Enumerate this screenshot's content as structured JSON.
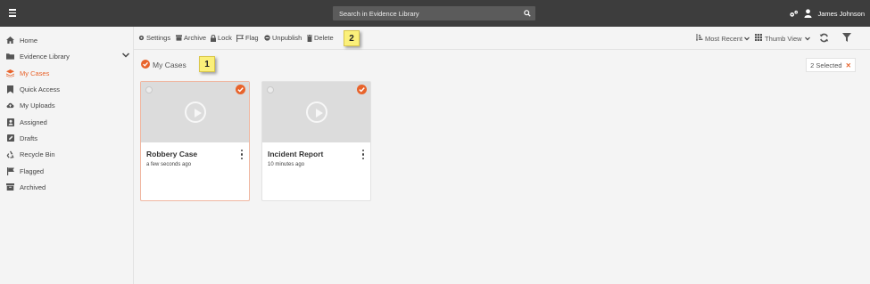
{
  "header": {
    "search_placeholder": "Search in Evidence Library",
    "user_name": "James Johnson"
  },
  "sidebar": {
    "items": [
      {
        "label": "Home",
        "icon": "home-icon"
      },
      {
        "label": "Evidence Library",
        "icon": "folder-icon"
      },
      {
        "label": "My Cases",
        "icon": "layers-icon",
        "active": true
      },
      {
        "label": "Quick Access",
        "icon": "bookmark-icon"
      },
      {
        "label": "My Uploads",
        "icon": "cloud-upload-icon"
      },
      {
        "label": "Assigned",
        "icon": "assigned-icon"
      },
      {
        "label": "Drafts",
        "icon": "edit-icon"
      },
      {
        "label": "Recycle Bin",
        "icon": "recycle-icon"
      },
      {
        "label": "Flagged",
        "icon": "flag-icon"
      },
      {
        "label": "Archived",
        "icon": "archive-icon"
      }
    ]
  },
  "toolbar": {
    "settings": "Settings",
    "archive": "Archive",
    "lock": "Lock",
    "flag": "Flag",
    "unpublish": "Unpublish",
    "delete": "Delete",
    "sort": "Most Recent",
    "view": "Thumb View"
  },
  "callouts": {
    "one": "1",
    "two": "2"
  },
  "section": {
    "title": "My Cases",
    "selected_text": "2 Selected",
    "clear_symbol": "✕"
  },
  "cards": [
    {
      "title": "Robbery Case",
      "time": "a few seconds ago",
      "selected": true
    },
    {
      "title": "Incident Report",
      "time": "10 minutes ago",
      "selected": true
    }
  ],
  "colors": {
    "accent": "#e8632b",
    "topbar": "#3d3d3d",
    "callout": "#fbf07a"
  }
}
